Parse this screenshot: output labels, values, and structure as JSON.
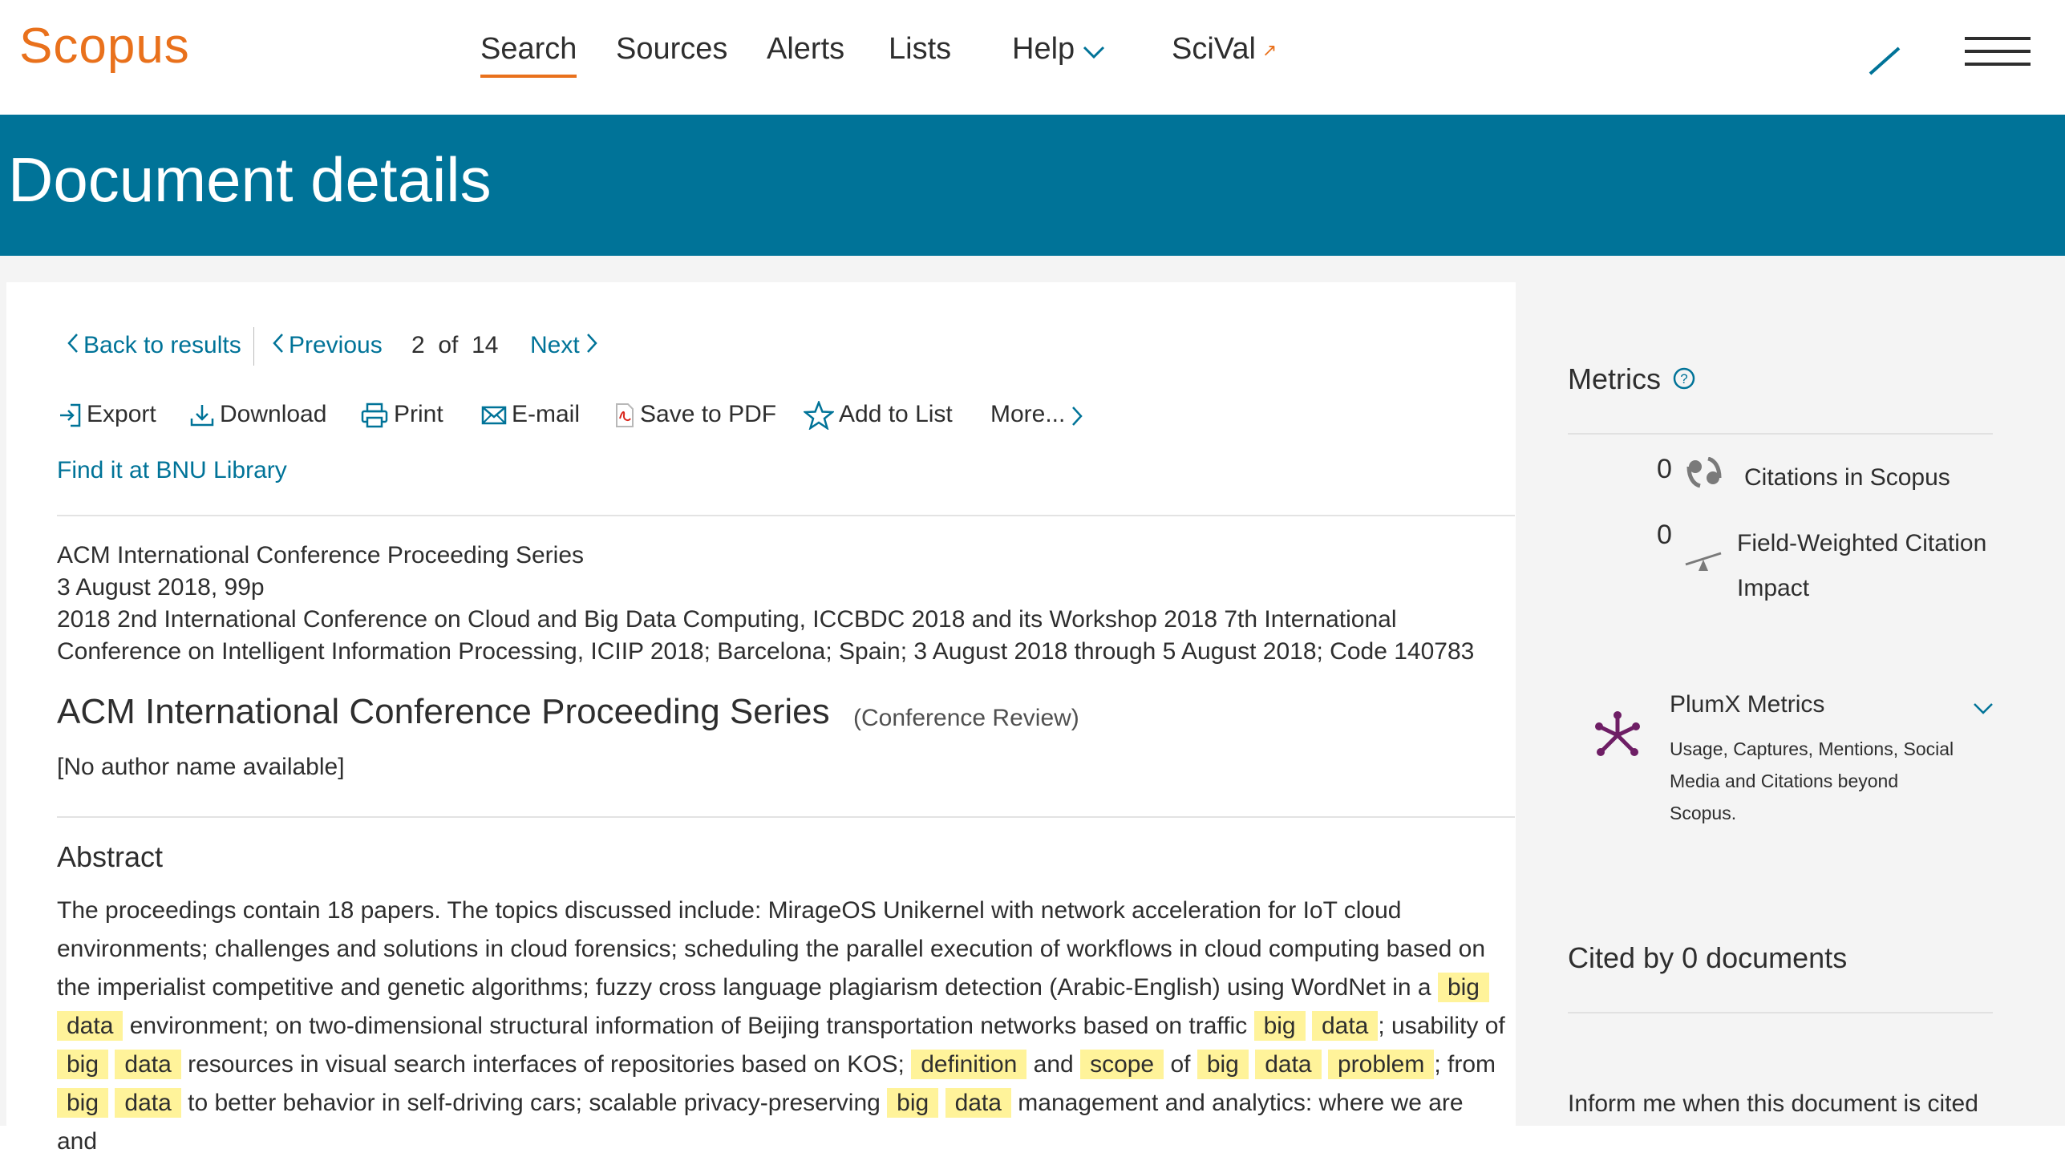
{
  "brand": {
    "name": "Scopus",
    "accent": "#e9711c",
    "header_blue": "#007398",
    "highlight": "#fff39a"
  },
  "nav": {
    "items": [
      {
        "label": "Search",
        "active": true
      },
      {
        "label": "Sources"
      },
      {
        "label": "Alerts"
      },
      {
        "label": "Lists"
      },
      {
        "label": "Help",
        "icon": "chevron-down-icon"
      },
      {
        "label": "SciVal",
        "icon": "external-link-icon"
      }
    ]
  },
  "header": {
    "title": "Document details"
  },
  "result_nav": {
    "back": "Back to results",
    "previous": "Previous",
    "position": "2",
    "of": "of",
    "total": "14",
    "next": "Next"
  },
  "actions": {
    "export": "Export",
    "download": "Download",
    "print": "Print",
    "email": "E-mail",
    "save_pdf": "Save to PDF",
    "add_list": "Add to List",
    "more": "More..."
  },
  "find_link": "Find it at BNU Library",
  "source": {
    "series": "ACM International Conference Proceeding Series",
    "date": "3 August 2018, 99p",
    "conference_line1": "2018 2nd International Conference on Cloud and Big Data Computing, ICCBDC 2018 and its Workshop 2018 7th International",
    "conference_line2": "Conference on Intelligent Information Processing, ICIIP 2018; Barcelona; Spain; 3 August 2018 through 5 August 2018; Code 140783"
  },
  "document": {
    "title": "ACM International Conference Proceeding Series",
    "type": "(Conference Review)",
    "authors": "[No author name available]"
  },
  "abstract": {
    "heading": "Abstract",
    "segments": [
      {
        "t": "The proceedings contain 18 papers. The topics discussed include: MirageOS Unikernel with network acceleration for IoT cloud environments; challenges and solutions in cloud forensics; scheduling the parallel execution of workflows in cloud computing based on the imperialist competitive and genetic algorithms; fuzzy cross language plagiarism detection (Arabic-English) using WordNet in a "
      },
      {
        "t": "big",
        "hl": true
      },
      {
        "t": " "
      },
      {
        "t": "data",
        "hl": true
      },
      {
        "t": " environment; on two-dimensional structural information of Beijing transportation networks based on traffic "
      },
      {
        "t": "big",
        "hl": true
      },
      {
        "t": " "
      },
      {
        "t": "data",
        "hl": true
      },
      {
        "t": "; usability of "
      },
      {
        "t": "big",
        "hl": true
      },
      {
        "t": " "
      },
      {
        "t": "data",
        "hl": true
      },
      {
        "t": " resources in visual search interfaces of repositories based on KOS; "
      },
      {
        "t": "definition",
        "hl": true
      },
      {
        "t": " and "
      },
      {
        "t": "scope",
        "hl": true
      },
      {
        "t": " of "
      },
      {
        "t": "big",
        "hl": true
      },
      {
        "t": " "
      },
      {
        "t": "data",
        "hl": true
      },
      {
        "t": " "
      },
      {
        "t": "problem",
        "hl": true
      },
      {
        "t": "; from "
      },
      {
        "t": "big",
        "hl": true
      },
      {
        "t": " "
      },
      {
        "t": "data",
        "hl": true
      },
      {
        "t": " to better behavior in self-driving cars; scalable privacy-preserving "
      },
      {
        "t": "big",
        "hl": true
      },
      {
        "t": " "
      },
      {
        "t": "data",
        "hl": true
      },
      {
        "t": " management and analytics: where we are and"
      }
    ]
  },
  "metrics": {
    "title": "Metrics",
    "citations_value": "0",
    "citations_label": "Citations in Scopus",
    "fwci_value": "0",
    "fwci_label_line1": "Field-Weighted Citation",
    "fwci_label_line2": "Impact",
    "plumx_title": "PlumX Metrics",
    "plumx_desc": "Usage, Captures, Mentions, Social Media and Citations beyond Scopus."
  },
  "cited_by": {
    "title": "Cited by 0 documents",
    "inform": "Inform me when this document is cited"
  }
}
